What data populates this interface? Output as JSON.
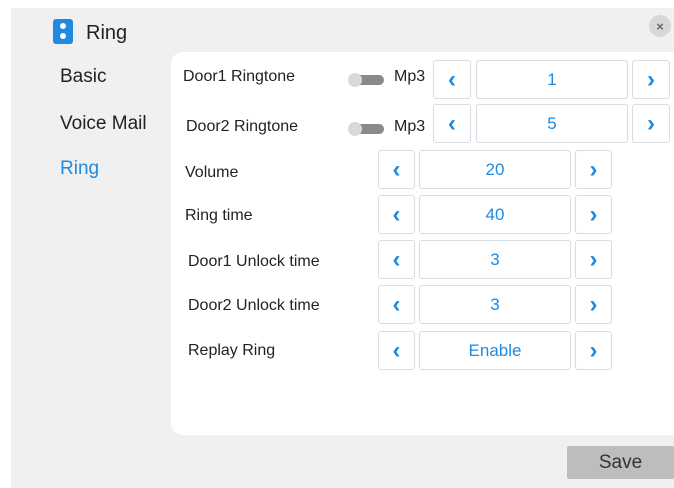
{
  "dialog": {
    "title": "Ring",
    "close_label": "×"
  },
  "nav": {
    "items": [
      "Basic",
      "Voice Mail",
      "Ring"
    ],
    "active": "Ring"
  },
  "rows": {
    "door1_ringtone": {
      "label": "Door1 Ringtone",
      "mode": "Mp3",
      "value": "1"
    },
    "door2_ringtone": {
      "label": "Door2 Ringtone",
      "mode": "Mp3",
      "value": "5"
    },
    "volume": {
      "label": "Volume",
      "value": "20"
    },
    "ring_time": {
      "label": "Ring time",
      "value": "40"
    },
    "door1_unlock": {
      "label": "Door1 Unlock time",
      "value": "3"
    },
    "door2_unlock": {
      "label": "Door2 Unlock time",
      "value": "3"
    },
    "replay_ring": {
      "label": "Replay Ring",
      "value": "Enable"
    }
  },
  "arrows": {
    "left": "‹",
    "right": "›"
  },
  "footer": {
    "save_label": "Save"
  },
  "colors": {
    "accent": "#1e8ae0",
    "panel_bg": "#f0f0f0",
    "save_bg": "#bdbdbd"
  }
}
